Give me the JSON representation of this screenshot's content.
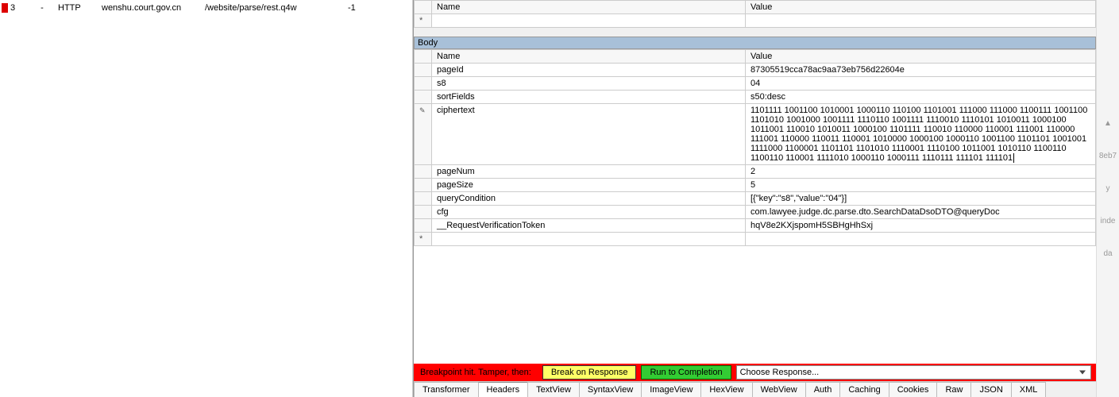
{
  "left": {
    "session": {
      "id": "3",
      "dash": "-",
      "protocol": "HTTP",
      "host": "wenshu.court.gov.cn",
      "path": "/website/parse/rest.q4w",
      "result": "-1"
    }
  },
  "topGrid": {
    "header": {
      "name": "Name",
      "value": "Value"
    }
  },
  "bodySection": {
    "title": "Body",
    "header": {
      "name": "Name",
      "value": "Value"
    },
    "rows": [
      {
        "name": "pageId",
        "value": "87305519cca78ac9aa73eb756d22604e"
      },
      {
        "name": "s8",
        "value": "04"
      },
      {
        "name": "sortFields",
        "value": "s50:desc"
      },
      {
        "name": "ciphertext",
        "value": "1101111 1001100 1010001 1000110 110100 1101001 111000 111000 1100111 1001100 1101010 1001000 1001111 1110110 1001111 1110010 1110101 1010011 1000100 1011001 110010 1010011 1000100 1101111 110010 110000 110001 111001 110000 111001 110000 110011 110001 1010000 1000100 1000110 1001100 1101101 1001001 1111000 1100001 1101101 1101010 1110001 1110100 1011001 1010110 1100110 1100110 110001 1111010 1000110 1000111 1110111 111101 111101"
      },
      {
        "name": "pageNum",
        "value": "2"
      },
      {
        "name": "pageSize",
        "value": "5"
      },
      {
        "name": "queryCondition",
        "value": "[{\"key\":\"s8\",\"value\":\"04\"}]"
      },
      {
        "name": "cfg",
        "value": "com.lawyee.judge.dc.parse.dto.SearchDataDsoDTO@queryDoc"
      },
      {
        "name": "__RequestVerificationToken",
        "value": "hqV8e2KXjspomH5SBHgHhSxj"
      }
    ]
  },
  "breakpoint": {
    "text": "Breakpoint hit. Tamper, then:",
    "btnBreak": "Break on Response",
    "btnRun": "Run to Completion",
    "choose": "Choose Response..."
  },
  "tabs": {
    "items": [
      "Transformer",
      "Headers",
      "TextView",
      "SyntaxView",
      "ImageView",
      "HexView",
      "WebView",
      "Auth",
      "Caching",
      "Cookies",
      "Raw",
      "JSON",
      "XML"
    ],
    "active": 1
  },
  "gutter": {
    "a": "8eb7",
    "b": "y",
    "c": "inde",
    "d": "da"
  }
}
